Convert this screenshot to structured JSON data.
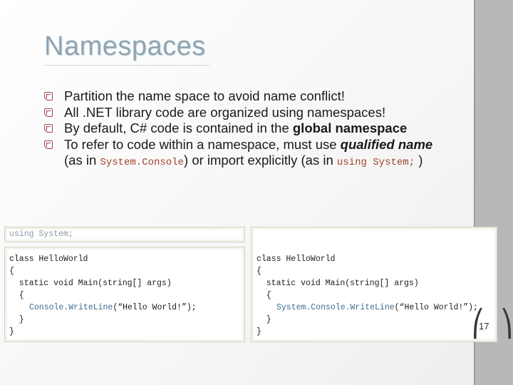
{
  "slide": {
    "title": "Namespaces",
    "bullets": {
      "b1": "Partition the name space to avoid name conflict!",
      "b2": "All .NET library code are organized using namespaces!",
      "b3_pre": "By default, C# code is contained in the ",
      "b3_bold": "global namespace",
      "b4_pre": "To refer to code within a namespace, must use ",
      "b4_bi": "qualified name",
      "b4_line2_pre": "(as in ",
      "b4_code1": "System.Console",
      "b4_mid": ") or import explicitly (as in ",
      "b4_code2": "using System;",
      "b4_end": " )"
    },
    "page_number": "17"
  },
  "code_left": {
    "using": "using System;",
    "lines": {
      "l1": "class HelloWorld",
      "l2": "{",
      "l3": "  static void Main(string[] args)",
      "l4": "  {",
      "l5_call": "Console.WriteLine",
      "l5_arg": "(“Hello World!”);",
      "l6": "  }",
      "l7": "}"
    }
  },
  "code_right": {
    "lines": {
      "l1": "class HelloWorld",
      "l2": "{",
      "l3": "  static void Main(string[] args)",
      "l4": "  {",
      "l5_call": "System.Console.WriteLine",
      "l5_arg": "(“Hello World!”);",
      "l6": "  }",
      "l7": "}"
    }
  },
  "colors": {
    "title": "#8ea5b3",
    "bullet_mark": "#a64444",
    "inline_code": "#a0442a",
    "side_bar": "#b8b8b8"
  }
}
